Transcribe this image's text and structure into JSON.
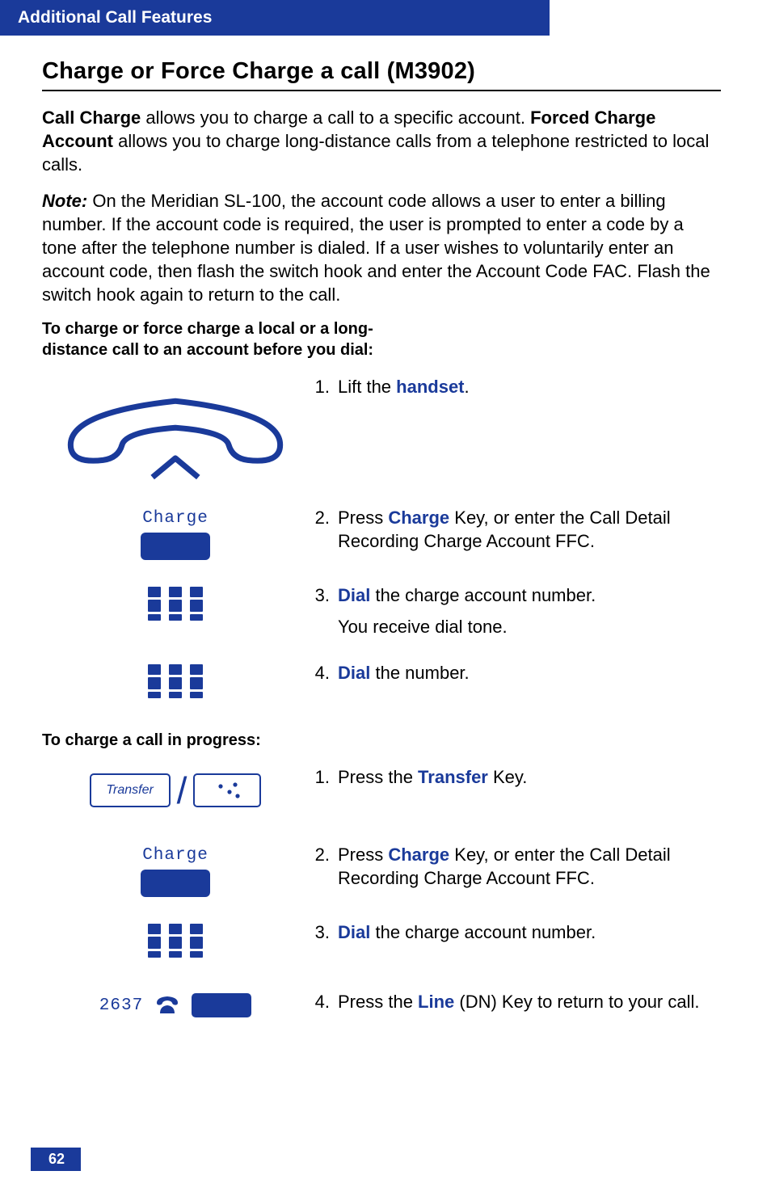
{
  "header": {
    "breadcrumb": "Additional Call Features"
  },
  "section": {
    "title": "Charge or Force Charge a call (M3902)"
  },
  "intro": {
    "pre": "Call Charge",
    "mid1": " allows you to charge a call to a specific account. ",
    "bold2": "Forced Charge Account",
    "mid2": " allows you to charge long-distance calls from a telephone restricted to local calls."
  },
  "note": {
    "label": "Note:",
    "text": " On the Meridian SL-100, the account code allows a user to enter a billing number. If the account code is required, the user is prompted to enter a code by a tone after the telephone number is dialed. If a user wishes to voluntarily enter an account code, then flash the switch hook and enter the Account Code FAC. Flash the switch hook again to return to the call."
  },
  "scenario1": {
    "title": "To charge or force charge a local or a long-distance call to an account before you dial:"
  },
  "softkey": {
    "charge_label": "Charge"
  },
  "transfer_key": {
    "label": "Transfer"
  },
  "line_key": {
    "dn": "2637"
  },
  "steps1": {
    "s1": {
      "num": "1.",
      "pre": "Lift the ",
      "hl": "handset",
      "post": "."
    },
    "s2": {
      "num": "2.",
      "pre": "Press ",
      "hl": "Charge",
      "post": " Key, or enter the Call Detail Recording Charge Account FFC."
    },
    "s3": {
      "num": "3.",
      "hl": "Dial",
      "post": " the charge account number.",
      "line2": "You receive dial tone."
    },
    "s4": {
      "num": "4.",
      "hl": "Dial",
      "post": " the number."
    }
  },
  "scenario2": {
    "title": "To charge a call in progress:"
  },
  "steps2": {
    "s1": {
      "num": "1.",
      "pre": "Press the ",
      "hl": "Transfer",
      "post": " Key."
    },
    "s2": {
      "num": "2.",
      "pre": "Press ",
      "hl": "Charge",
      "post": " Key, or enter the Call Detail Recording Charge Account FFC."
    },
    "s3": {
      "num": "3.",
      "hl": "Dial",
      "post": " the charge account number."
    },
    "s4": {
      "num": "4.",
      "pre": "Press the ",
      "hl": "Line",
      "post": " (DN) Key to return to your call."
    }
  },
  "footer": {
    "page": "62"
  }
}
